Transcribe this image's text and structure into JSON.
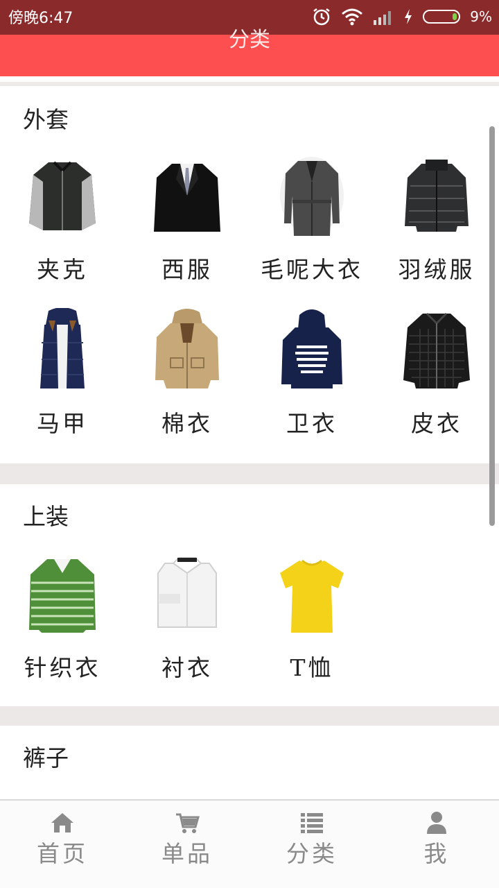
{
  "status_bar": {
    "time": "傍晚6:47",
    "battery": "9%"
  },
  "header": {
    "title": "分类"
  },
  "sections": [
    {
      "title": "外套",
      "items": [
        {
          "label": "夹克",
          "icon": "jacket-icon"
        },
        {
          "label": "西服",
          "icon": "suit-icon"
        },
        {
          "label": "毛呢大衣",
          "icon": "wool-coat-icon"
        },
        {
          "label": "羽绒服",
          "icon": "down-jacket-icon"
        },
        {
          "label": "马甲",
          "icon": "vest-icon"
        },
        {
          "label": "棉衣",
          "icon": "cotton-coat-icon"
        },
        {
          "label": "卫衣",
          "icon": "hoodie-icon"
        },
        {
          "label": "皮衣",
          "icon": "leather-jacket-icon"
        }
      ]
    },
    {
      "title": "上装",
      "items": [
        {
          "label": "针织衣",
          "icon": "knit-sweater-icon"
        },
        {
          "label": "衬衣",
          "icon": "shirt-icon"
        },
        {
          "label": "T恤",
          "icon": "tshirt-icon"
        }
      ]
    },
    {
      "title": "裤子",
      "items": []
    }
  ],
  "nav": [
    {
      "label": "首页",
      "icon": "home-icon"
    },
    {
      "label": "单品",
      "icon": "cart-icon"
    },
    {
      "label": "分类",
      "icon": "list-icon"
    },
    {
      "label": "我",
      "icon": "user-icon"
    }
  ],
  "colors": {
    "header": "#fd4f50",
    "status_bar": "#8a2a2b",
    "nav_text": "#8a8a8a"
  }
}
